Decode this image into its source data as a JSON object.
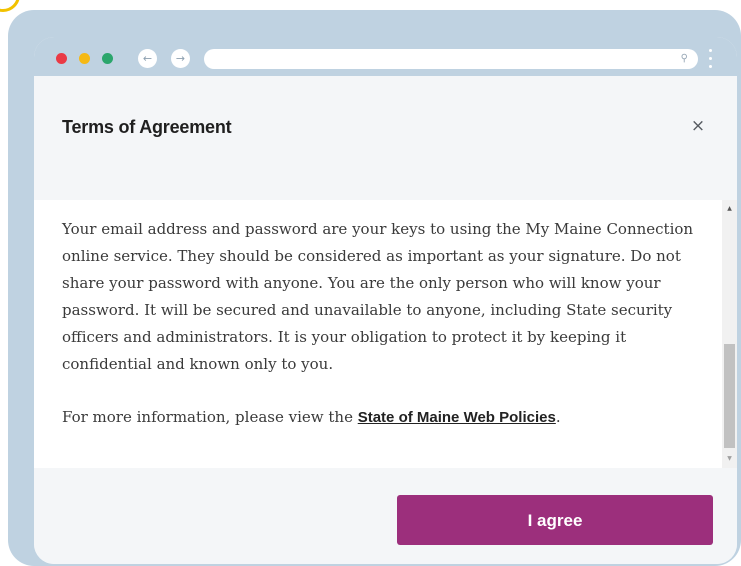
{
  "browser": {
    "back_icon": "←",
    "forward_icon": "→",
    "search_icon": "⚲"
  },
  "modal": {
    "title": "Terms of Agreement",
    "close_icon": "×",
    "paragraph1": "Your email address and password are your keys to using the My Maine Connection online service. They should be considered as important as your signature. Do not share your password with anyone. You are the only person who will know your password. It will be secured and unavailable to anyone, including State security officers and administrators. It is your obligation to protect it by keeping it confidential and known only to you.",
    "paragraph2_prefix": "For more information, please view the ",
    "policy_link": "State of Maine Web Policies",
    "paragraph2_suffix": ".",
    "agree_button": "I agree"
  },
  "scrollbar": {
    "up_arrow": "▲",
    "down_arrow": "▼"
  },
  "colors": {
    "accent": "#9c2f7c",
    "frame": "#bfd2e1",
    "close_red": "#ea3a45",
    "minimize_yellow": "#f5b915",
    "maximize_green": "#2ba66c"
  }
}
